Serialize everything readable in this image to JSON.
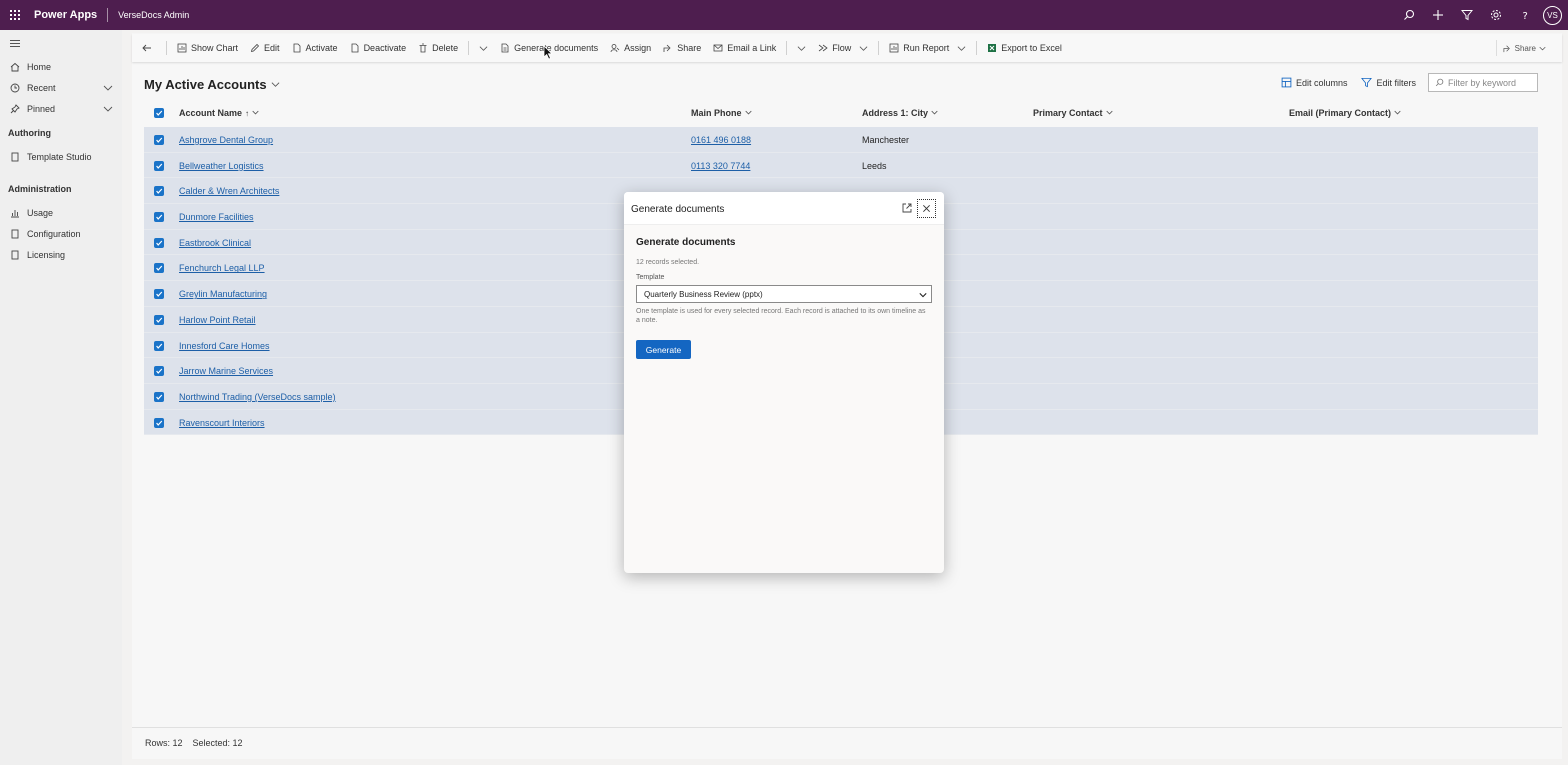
{
  "topbar": {
    "app_name": "Power Apps",
    "environment": "VerseDocs Admin",
    "avatar_initials": "VS",
    "icons": [
      "search-icon",
      "plus-icon",
      "filter-icon",
      "gear-icon",
      "help-icon"
    ],
    "background": "#4e1e4f"
  },
  "leftnav": {
    "items": [
      {
        "label": "Home",
        "icon": "home-icon"
      },
      {
        "label": "Recent",
        "icon": "clock-icon"
      },
      {
        "label": "Pinned",
        "icon": "pin-icon"
      }
    ],
    "authoring_heading": "Authoring",
    "authoring_items": [
      {
        "label": "Template Studio",
        "icon": "document-icon"
      }
    ],
    "administration_heading": "Administration",
    "administration_items": [
      {
        "label": "Usage",
        "icon": "chart-icon"
      },
      {
        "label": "Configuration",
        "icon": "document-icon"
      },
      {
        "label": "Licensing",
        "icon": "document-icon"
      }
    ]
  },
  "cmdbar": {
    "items": [
      {
        "label": "Show Chart",
        "icon": "chart-icon"
      },
      {
        "label": "Edit",
        "icon": "pencil-icon"
      },
      {
        "label": "Activate",
        "icon": "document-icon"
      },
      {
        "label": "Deactivate",
        "icon": "document-icon"
      },
      {
        "label": "Delete",
        "icon": "trash-icon"
      },
      {
        "label": "Generate documents",
        "icon": "document-gen-icon"
      },
      {
        "label": "Assign",
        "icon": "person-icon"
      },
      {
        "label": "Share",
        "icon": "share-icon"
      },
      {
        "label": "Email a Link",
        "icon": "email-icon"
      },
      {
        "label": "Flow",
        "icon": "flow-icon"
      },
      {
        "label": "Run Report",
        "icon": "report-icon"
      },
      {
        "label": "Export to Excel",
        "icon": "excel-icon"
      }
    ],
    "share_right": "Share"
  },
  "view": {
    "title": "My Active Accounts",
    "edit_columns": "Edit columns",
    "edit_filters": "Edit filters",
    "filter_placeholder": "Filter by keyword"
  },
  "grid": {
    "headers": {
      "account_name": "Account Name",
      "main_phone": "Main Phone",
      "city": "Address 1: City",
      "primary_contact": "Primary Contact",
      "email": "Email (Primary Contact)"
    },
    "rows": [
      {
        "name": "Ashgrove Dental Group",
        "phone": "0161 496 0188",
        "city": "Manchester"
      },
      {
        "name": "Bellweather Logistics",
        "phone": "0113 320 7744",
        "city": "Leeds"
      },
      {
        "name": "Calder & Wren Architects",
        "phone": "",
        "city": ""
      },
      {
        "name": "Dunmore Facilities",
        "phone": "",
        "city": ""
      },
      {
        "name": "Eastbrook Clinical",
        "phone": "",
        "city": ""
      },
      {
        "name": "Fenchurch Legal LLP",
        "phone": "",
        "city": ""
      },
      {
        "name": "Greylin Manufacturing",
        "phone": "",
        "city": ""
      },
      {
        "name": "Harlow Point Retail",
        "phone": "",
        "city": ""
      },
      {
        "name": "Innesford Care Homes",
        "phone": "",
        "city": ""
      },
      {
        "name": "Jarrow Marine Services",
        "phone": "",
        "city": ""
      },
      {
        "name": "Northwind Trading (VerseDocs sample)",
        "phone": "",
        "city": ""
      },
      {
        "name": "Ravenscourt Interiors",
        "phone": "",
        "city": ""
      }
    ],
    "selected_color": "#dde2eb",
    "link_color": "#1d5fa7"
  },
  "footer": {
    "rows": "Rows: 12",
    "selected": "Selected: 12"
  },
  "dialog": {
    "header_title": "Generate documents",
    "heading": "Generate documents",
    "record_count": "12 records selected.",
    "template_label": "Template",
    "template_value": "Quarterly Business Review (pptx)",
    "help_text": "One template is used for every selected record. Each record is attached to its own timeline as a note.",
    "generate_button": "Generate",
    "accent": "#1466c2"
  }
}
